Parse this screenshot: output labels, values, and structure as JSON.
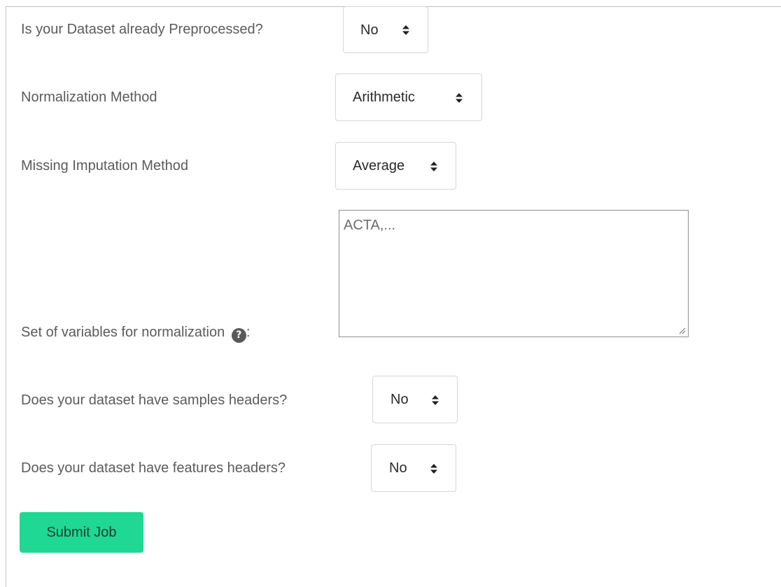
{
  "form": {
    "preprocessed": {
      "label": "Is your Dataset already Preprocessed?",
      "value": "No"
    },
    "normalization": {
      "label": "Normalization Method",
      "value": "Arithmetic"
    },
    "imputation": {
      "label": "Missing Imputation Method",
      "value": "Average"
    },
    "variables": {
      "label": "Set of variables for normalization",
      "label_suffix": ":",
      "help_glyph": "?",
      "placeholder": "ACTA,..."
    },
    "samples_headers": {
      "label": "Does your dataset have samples headers?",
      "value": "No"
    },
    "features_headers": {
      "label": "Does your dataset have features headers?",
      "value": "No"
    },
    "submit_label": "Submit Job"
  },
  "icons": {
    "select_arrows": "sort-icon",
    "help": "question-circle-icon",
    "resize": "resize-grip-icon"
  },
  "colors": {
    "submit_bg": "#1ed893",
    "label_text": "#5b5b5b",
    "border": "#d6d6d6"
  }
}
